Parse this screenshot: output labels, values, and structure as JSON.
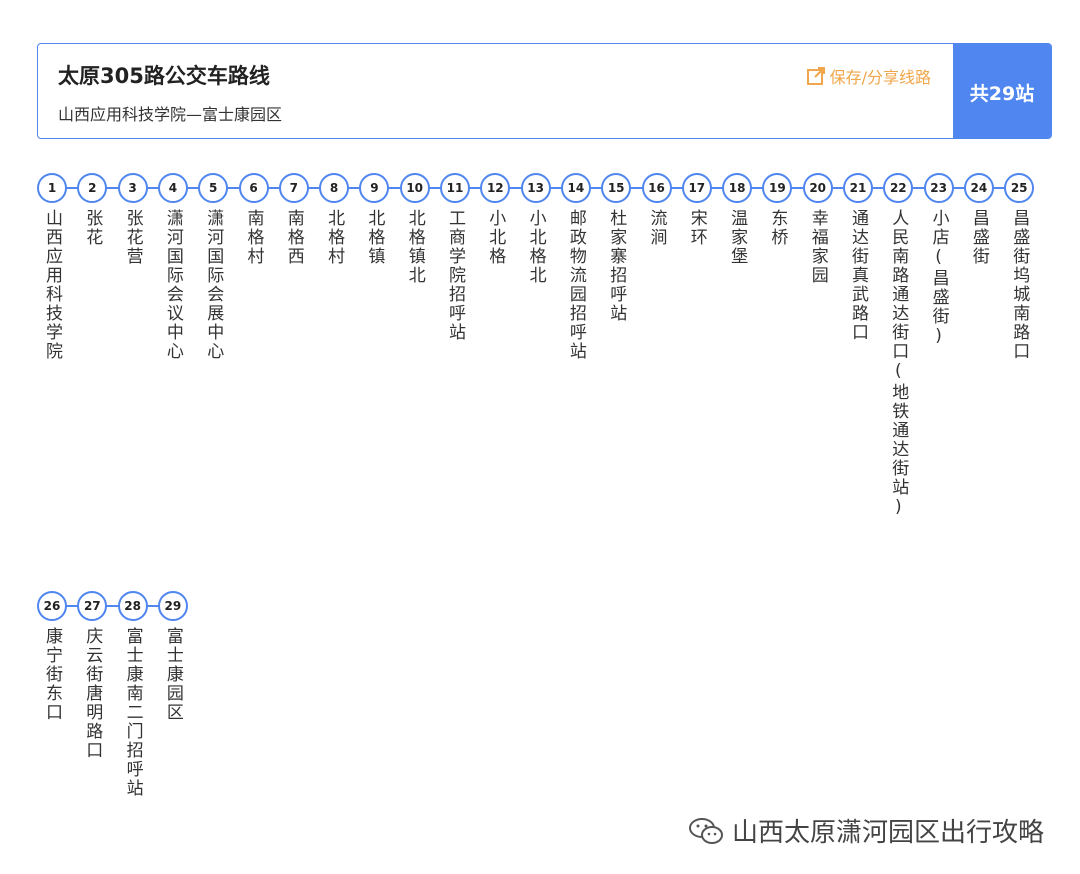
{
  "header": {
    "title": "太原305路公交车路线",
    "subtitle": "山西应用科技学院—富士康园区",
    "save_label": "保存/分享线路",
    "stop_count": "共29站"
  },
  "stops": [
    {
      "num": "1",
      "name": "山西应用科技学院"
    },
    {
      "num": "2",
      "name": "张花"
    },
    {
      "num": "3",
      "name": "张花营"
    },
    {
      "num": "4",
      "name": "潇河国际会议中心"
    },
    {
      "num": "5",
      "name": "潇河国际会展中心"
    },
    {
      "num": "6",
      "name": "南格村"
    },
    {
      "num": "7",
      "name": "南格西"
    },
    {
      "num": "8",
      "name": "北格村"
    },
    {
      "num": "9",
      "name": "北格镇"
    },
    {
      "num": "10",
      "name": "北格镇北"
    },
    {
      "num": "11",
      "name": "工商学院招呼站"
    },
    {
      "num": "12",
      "name": "小北格"
    },
    {
      "num": "13",
      "name": "小北格北"
    },
    {
      "num": "14",
      "name": "邮政物流园招呼站"
    },
    {
      "num": "15",
      "name": "杜家寨招呼站"
    },
    {
      "num": "16",
      "name": "流涧"
    },
    {
      "num": "17",
      "name": "宋环"
    },
    {
      "num": "18",
      "name": "温家堡"
    },
    {
      "num": "19",
      "name": "东桥"
    },
    {
      "num": "20",
      "name": "幸福家园"
    },
    {
      "num": "21",
      "name": "通达街真武路口"
    },
    {
      "num": "22",
      "name": "人民南路通达街口(地铁通达街站)"
    },
    {
      "num": "23",
      "name": "小店(昌盛街)"
    },
    {
      "num": "24",
      "name": "昌盛街"
    },
    {
      "num": "25",
      "name": "昌盛街坞城南路口"
    },
    {
      "num": "26",
      "name": "康宁街东口"
    },
    {
      "num": "27",
      "name": "庆云街唐明路口"
    },
    {
      "num": "28",
      "name": "富士康南二门招呼站"
    },
    {
      "num": "29",
      "name": "富士康园区"
    }
  ],
  "watermark": "山西太原潇河园区出行攻略",
  "colors": {
    "accent": "#4f86f0",
    "save_link": "#f0a64a"
  },
  "icons": {
    "save": "share-external-icon",
    "watermark": "wechat-icon"
  }
}
